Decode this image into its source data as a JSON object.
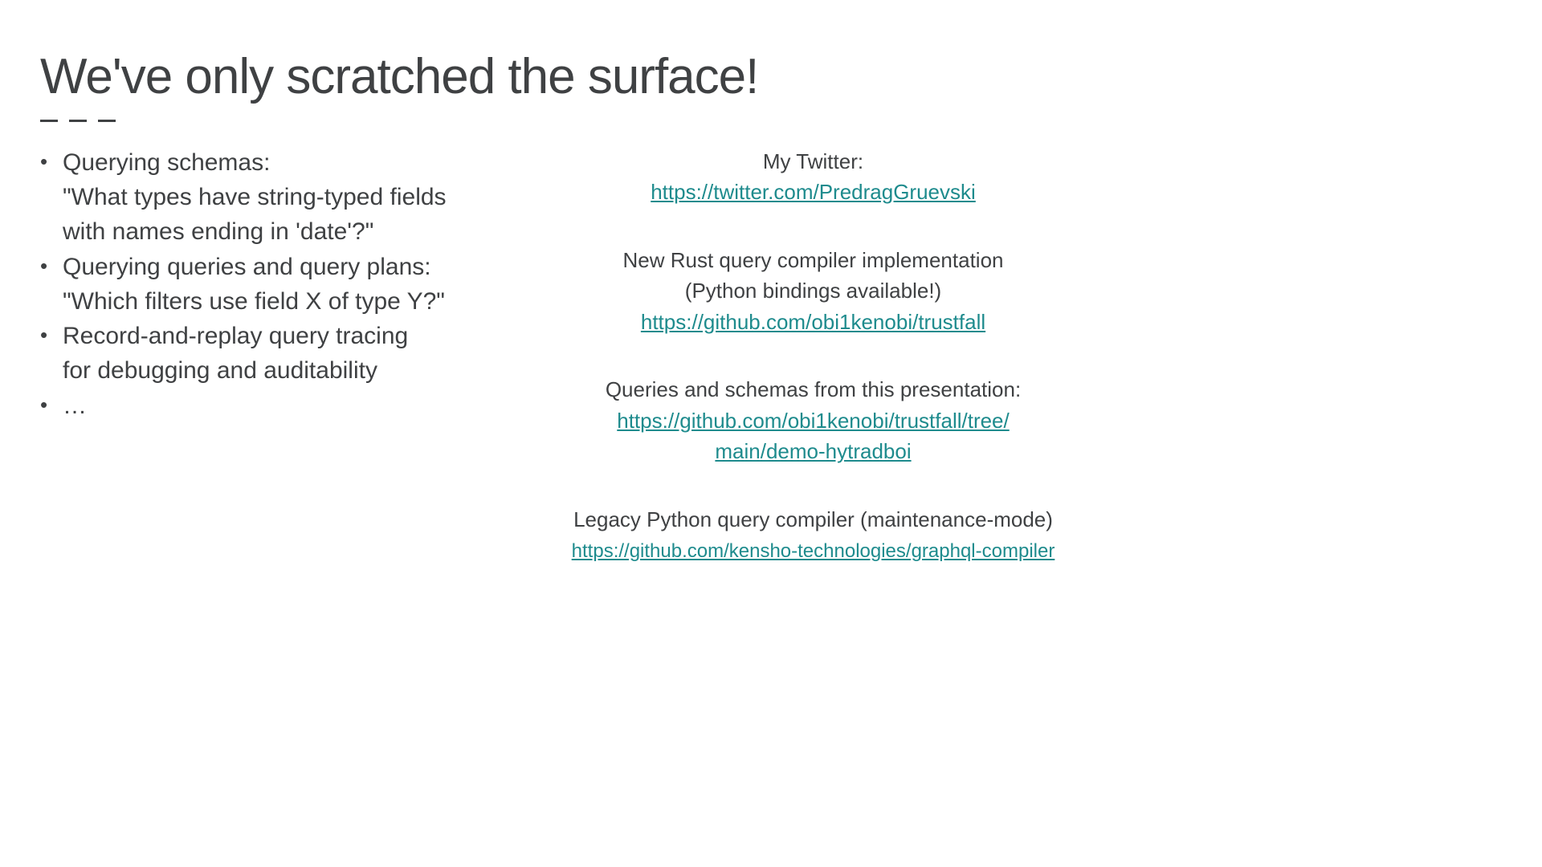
{
  "title": "We've only scratched the surface!",
  "bullets": {
    "b1l1": "Querying schemas:",
    "b1l2": "\"What types have string-typed fields",
    "b1l3": "with names ending in 'date'?\"",
    "b2l1": "Querying queries and query plans:",
    "b2l2": "\"Which filters use field X of type Y?\"",
    "b3l1": "Record-and-replay query tracing",
    "b3l2": "for debugging and auditability",
    "b4l1": "…"
  },
  "right": {
    "twitter_label": "My Twitter:",
    "twitter_link": "https://twitter.com/PredragGruevski",
    "rust_l1": "New Rust query compiler implementation",
    "rust_l2": "(Python bindings available!)",
    "rust_link": "https://github.com/obi1kenobi/trustfall",
    "pres_l1": "Queries and schemas from this presentation:",
    "pres_link_l1": "https://github.com/obi1kenobi/trustfall/tree/",
    "pres_link_l2": "main/demo-hytradboi",
    "legacy_l1": "Legacy Python query compiler (maintenance-mode)",
    "legacy_link": "https://github.com/kensho-technologies/graphql-compiler"
  }
}
